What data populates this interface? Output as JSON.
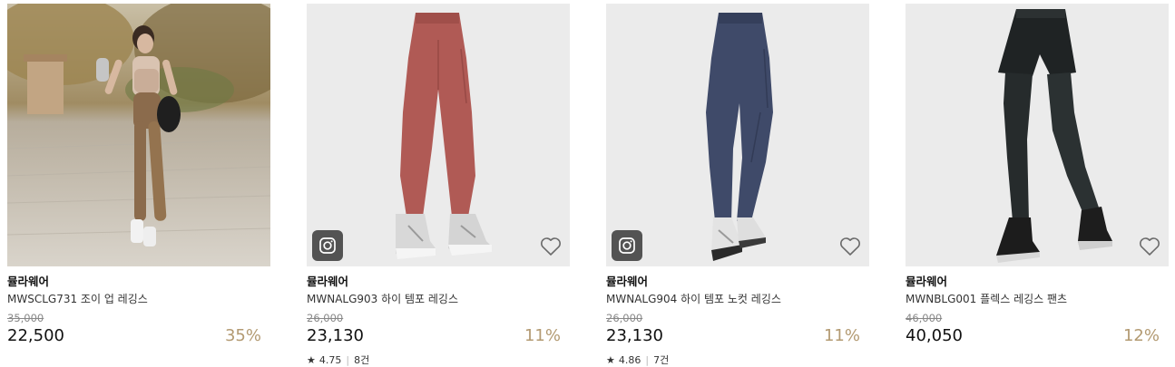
{
  "products": [
    {
      "brand": "뮬라웨어",
      "name": "MWSCLG731 조이 업 레깅스",
      "original_price": "35,000",
      "price": "22,500",
      "discount": "35%"
    },
    {
      "brand": "뮬라웨어",
      "name": "MWNALG903 하이 템포 레깅스",
      "original_price": "26,000",
      "price": "23,130",
      "discount": "11%",
      "rating": "4.75",
      "review_count": "8건"
    },
    {
      "brand": "뮬라웨어",
      "name": "MWNALG904 하이 템포 노컷 레깅스",
      "original_price": "26,000",
      "price": "23,130",
      "discount": "11%",
      "rating": "4.86",
      "review_count": "7건"
    },
    {
      "brand": "뮬라웨어",
      "name": "MWNBLG001 플렉스 레깅스 팬츠",
      "original_price": "46,000",
      "price": "40,050",
      "discount": "12%"
    }
  ],
  "colors": {
    "discount": "#b39a72",
    "leggings_rose": "#b05a55",
    "leggings_navy": "#3f4a69",
    "leggings_black": "#262b2c"
  }
}
